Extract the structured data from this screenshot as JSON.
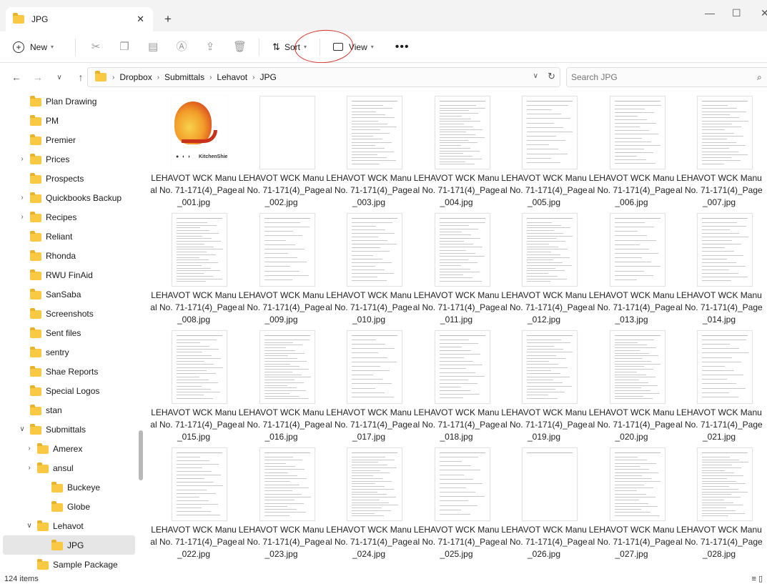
{
  "window": {
    "tab_title": "JPG",
    "minimize": "—",
    "maximize": "☐",
    "close": "✕"
  },
  "toolbar": {
    "new_label": "New",
    "sort_label": "Sort",
    "view_label": "View",
    "more_label": "•••"
  },
  "address": {
    "breadcrumbs": [
      "Dropbox",
      "Submittals",
      "Lehavot",
      "JPG"
    ],
    "search_placeholder": "Search JPG"
  },
  "sidebar": {
    "items": [
      {
        "label": "Plan Drawing",
        "expander": ""
      },
      {
        "label": "PM",
        "expander": ""
      },
      {
        "label": "Premier",
        "expander": ""
      },
      {
        "label": "Prices",
        "expander": ">"
      },
      {
        "label": "Prospects",
        "expander": ""
      },
      {
        "label": "Quickbooks Backup",
        "expander": ">"
      },
      {
        "label": "Recipes",
        "expander": ">"
      },
      {
        "label": "Reliant",
        "expander": ""
      },
      {
        "label": "Rhonda",
        "expander": ""
      },
      {
        "label": "RWU FinAid",
        "expander": ""
      },
      {
        "label": "SanSaba",
        "expander": ""
      },
      {
        "label": "Screenshots",
        "expander": ""
      },
      {
        "label": "Sent files",
        "expander": ""
      },
      {
        "label": "sentry",
        "expander": ""
      },
      {
        "label": "Shae Reports",
        "expander": ""
      },
      {
        "label": "Special Logos",
        "expander": ""
      },
      {
        "label": "stan",
        "expander": ""
      },
      {
        "label": "Submittals",
        "expander": "v"
      },
      {
        "label": "Amerex",
        "expander": ">"
      },
      {
        "label": "ansul",
        "expander": ">"
      },
      {
        "label": "Buckeye",
        "expander": ""
      },
      {
        "label": "Globe",
        "expander": ""
      },
      {
        "label": "Lehavot",
        "expander": "v"
      },
      {
        "label": "JPG",
        "expander": ""
      },
      {
        "label": "Sample Package",
        "expander": ""
      }
    ]
  },
  "files": [
    {
      "name": "LEHAVOT WCK Manual No. 71-171(4)_Page_001.jpg"
    },
    {
      "name": "LEHAVOT WCK Manual No. 71-171(4)_Page_002.jpg"
    },
    {
      "name": "LEHAVOT WCK Manual No. 71-171(4)_Page_003.jpg"
    },
    {
      "name": "LEHAVOT WCK Manual No. 71-171(4)_Page_004.jpg"
    },
    {
      "name": "LEHAVOT WCK Manual No. 71-171(4)_Page_005.jpg"
    },
    {
      "name": "LEHAVOT WCK Manual No. 71-171(4)_Page_006.jpg"
    },
    {
      "name": "LEHAVOT WCK Manual No. 71-171(4)_Page_007.jpg"
    },
    {
      "name": "LEHAVOT WCK Manual No. 71-171(4)_Page_008.jpg"
    },
    {
      "name": "LEHAVOT WCK Manual No. 71-171(4)_Page_009.jpg"
    },
    {
      "name": "LEHAVOT WCK Manual No. 71-171(4)_Page_010.jpg"
    },
    {
      "name": "LEHAVOT WCK Manual No. 71-171(4)_Page_011.jpg"
    },
    {
      "name": "LEHAVOT WCK Manual No. 71-171(4)_Page_012.jpg"
    },
    {
      "name": "LEHAVOT WCK Manual No. 71-171(4)_Page_013.jpg"
    },
    {
      "name": "LEHAVOT WCK Manual No. 71-171(4)_Page_014.jpg"
    },
    {
      "name": "LEHAVOT WCK Manual No. 71-171(4)_Page_015.jpg"
    },
    {
      "name": "LEHAVOT WCK Manual No. 71-171(4)_Page_016.jpg"
    },
    {
      "name": "LEHAVOT WCK Manual No. 71-171(4)_Page_017.jpg"
    },
    {
      "name": "LEHAVOT WCK Manual No. 71-171(4)_Page_018.jpg"
    },
    {
      "name": "LEHAVOT WCK Manual No. 71-171(4)_Page_019.jpg"
    },
    {
      "name": "LEHAVOT WCK Manual No. 71-171(4)_Page_020.jpg"
    },
    {
      "name": "LEHAVOT WCK Manual No. 71-171(4)_Page_021.jpg"
    },
    {
      "name": "LEHAVOT WCK Manual No. 71-171(4)_Page_022.jpg"
    },
    {
      "name": "LEHAVOT WCK Manual No. 71-171(4)_Page_023.jpg"
    },
    {
      "name": "LEHAVOT WCK Manual No. 71-171(4)_Page_024.jpg"
    },
    {
      "name": "LEHAVOT WCK Manual No. 71-171(4)_Page_025.jpg"
    },
    {
      "name": "LEHAVOT WCK Manual No. 71-171(4)_Page_026.jpg"
    },
    {
      "name": "LEHAVOT WCK Manual No. 71-171(4)_Page_027.jpg"
    },
    {
      "name": "LEHAVOT WCK Manual No. 71-171(4)_Page_028.jpg"
    }
  ],
  "status": {
    "item_count": "124 items"
  }
}
